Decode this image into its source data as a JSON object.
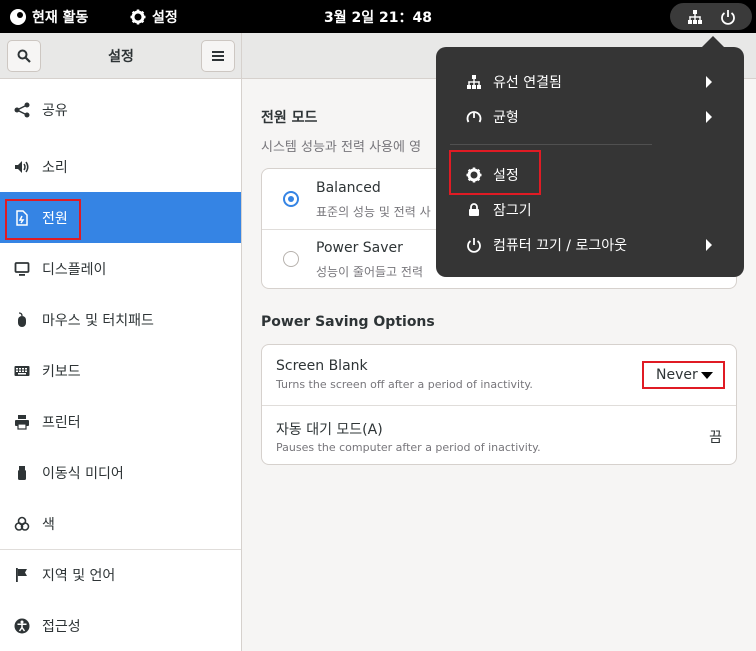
{
  "topbar": {
    "activities_label": "현재 활동",
    "app_name": "설정",
    "clock": "3월 2일  21：48"
  },
  "sidebar": {
    "title": "설정",
    "items": [
      {
        "label": "공유",
        "icon": "share-icon"
      },
      {
        "label": "소리",
        "icon": "speaker-icon"
      },
      {
        "label": "전원",
        "icon": "power-plug-icon",
        "selected": true
      },
      {
        "label": "디스플레이",
        "icon": "monitor-icon"
      },
      {
        "label": "마우스 및 터치패드",
        "icon": "mouse-icon"
      },
      {
        "label": "키보드",
        "icon": "keyboard-icon"
      },
      {
        "label": "프린터",
        "icon": "printer-icon"
      },
      {
        "label": "이동식 미디어",
        "icon": "usb-drive-icon"
      },
      {
        "label": "색",
        "icon": "color-icon"
      },
      {
        "label": "지역 및 언어",
        "icon": "flag-icon"
      },
      {
        "label": "접근성",
        "icon": "accessibility-icon"
      }
    ]
  },
  "power_mode": {
    "title": "전원 모드",
    "subtitle": "시스템 성능과 전력 사용에 영",
    "options": [
      {
        "label": "Balanced",
        "desc": "표준의 성능 및 전력 사",
        "selected": true
      },
      {
        "label": "Power Saver",
        "desc": "성능이 줄어들고 전력",
        "selected": false
      }
    ]
  },
  "power_saving": {
    "title": "Power Saving Options",
    "screen_blank": {
      "label": "Screen Blank",
      "desc": "Turns the screen off after a period of inactivity.",
      "value": "Never"
    },
    "auto_suspend": {
      "label": "자동 대기 모드(A)",
      "desc": "Pauses the computer after a period of inactivity.",
      "value": "끔"
    }
  },
  "popup_menu": {
    "items": [
      {
        "label": "유선 연결됨",
        "icon": "network-wired-icon",
        "has_submenu": true
      },
      {
        "label": "균형",
        "icon": "power-profile-icon",
        "has_submenu": true
      },
      {
        "label": "설정",
        "icon": "gear-icon",
        "has_submenu": false
      },
      {
        "label": "잠그기",
        "icon": "lock-icon",
        "has_submenu": false
      },
      {
        "label": "컴퓨터 끄기 / 로그아웃",
        "icon": "power-icon",
        "has_submenu": true
      }
    ]
  },
  "colors": {
    "accent": "#3584e4",
    "highlight": "#e01b24",
    "popup_bg": "#353535"
  }
}
